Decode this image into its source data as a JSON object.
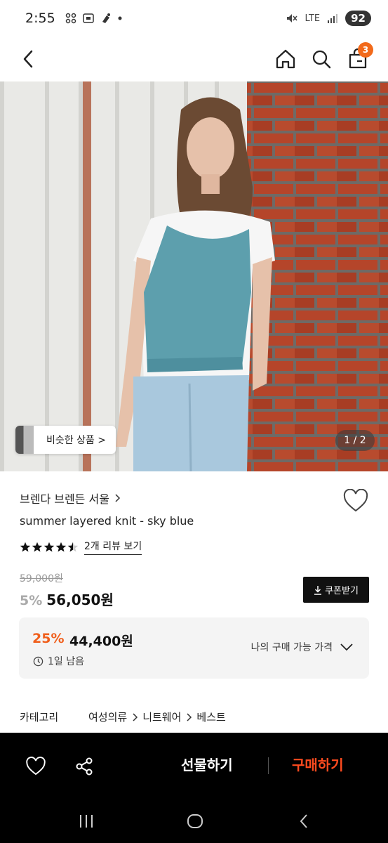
{
  "status_bar": {
    "time": "2:55",
    "left_icons": [
      "grid-app-icon",
      "screenshot-icon",
      "voice-icon",
      "dot-icon"
    ],
    "network": "LTE",
    "battery": "92"
  },
  "nav": {
    "icons": [
      "back-arrow-icon",
      "home-icon",
      "search-icon",
      "cart-icon"
    ],
    "cart_count": "3"
  },
  "image": {
    "similar_label": "비슷한 상품 >",
    "page_indicator": "1 / 2"
  },
  "product": {
    "brand": "브렌다 브렌든 서울",
    "name": "summer layered knit - sky blue",
    "rating": 4.5,
    "review_link": "2개 리뷰 보기",
    "original_price": "59,000원",
    "discount": "5%",
    "price": "56,050원",
    "coupon_label": "쿠폰받기"
  },
  "price_box": {
    "discount": "25%",
    "price": "44,400원",
    "timer": "1일 남음",
    "my_price_label": "나의 구매 가능 가격"
  },
  "category": {
    "label": "카테고리",
    "crumbs": [
      "여성의류",
      "니트웨어",
      "베스트"
    ]
  },
  "bottom_bar": {
    "gift_label": "선물하기",
    "buy_label": "구매하기"
  },
  "colors": {
    "accent_orange": "#f05f1c",
    "buy_red": "#ff4b1f",
    "badge_orange": "#f26a1b"
  }
}
